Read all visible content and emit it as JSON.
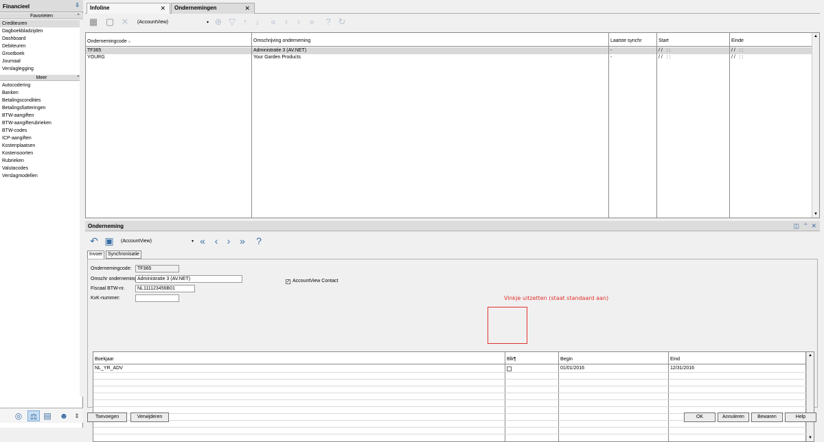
{
  "sidebar": {
    "title": "Financieel",
    "group_favorites": "Favorieten",
    "favorites": [
      "Crediteuren",
      "Dagboekbladzijden",
      "Dashboard",
      "Debiteuren",
      "Grootboek",
      "Journaal",
      "Verslaglegging"
    ],
    "selected": "Crediteuren",
    "group_more": "Meer",
    "more": [
      "Autocodering",
      "Banken",
      "Betalingscondities",
      "Betalingsfiatteringen",
      "BTW-aangiften",
      "BTW-aangifterubrieken",
      "BTW-codes",
      "ICP-aangiften",
      "Kostenplaatsen",
      "Kostensoorten",
      "Rubrieken",
      "Valutacodes",
      "Verslagmodellen"
    ],
    "bottom_icons": [
      "compass-icon",
      "scales-icon",
      "document-icon",
      "people-icon"
    ]
  },
  "tabs": [
    {
      "label": "Infoline",
      "active": false
    },
    {
      "label": "Ondernemingen",
      "active": true
    }
  ],
  "toolbar": {
    "view": "(AccountView)"
  },
  "grid": {
    "columns": [
      "Ondernemingcode",
      "Omschrijving onderneming",
      "Laatste synchr",
      "Start",
      "Einde"
    ],
    "rows": [
      [
        "TF365",
        "Administratie 3 (AV.NET)",
        "-",
        "/ /   : :",
        "/ /   : :"
      ],
      [
        "YOURG",
        "Your Garden Products",
        "-",
        "/ /   : :",
        "/ /   : :"
      ]
    ]
  },
  "panel": {
    "title": "Onderneming",
    "view": "(AccountView)",
    "subtabs": [
      "Invoer",
      "Synchronisatie"
    ],
    "fields": {
      "code_label": "Ondernemingcode:",
      "code_value": "TF365",
      "desc_label": "Omschr onderneming:",
      "desc_value": "Administratie 3 (AV.NET)",
      "vat_label": "Fiscaal BTW-nr.",
      "vat_value": "NL111123456B01",
      "kvk_label": "KvK-nummer:",
      "kvk_value": "",
      "contact_label": "AccountView Contact",
      "contact_checked": true
    },
    "grid": {
      "columns": [
        "Boekjaar",
        "Blk¶",
        "Begin",
        "Eind"
      ],
      "rows": [
        [
          "NL_YR_ADV",
          "",
          "01/01/2016",
          "12/31/2016"
        ]
      ]
    },
    "annotation": "Vinkje uitzetten (staat standaard aan)"
  },
  "buttons": {
    "add": "Toevoegen",
    "remove": "Verwijderen",
    "ok": "OK",
    "cancel": "Annuleren",
    "save": "Bewaren",
    "help": "Help"
  },
  "colors": {
    "annotation": "#e0302a",
    "selection": "#dcdcdc",
    "icon_blue": "#3a6ea5"
  }
}
